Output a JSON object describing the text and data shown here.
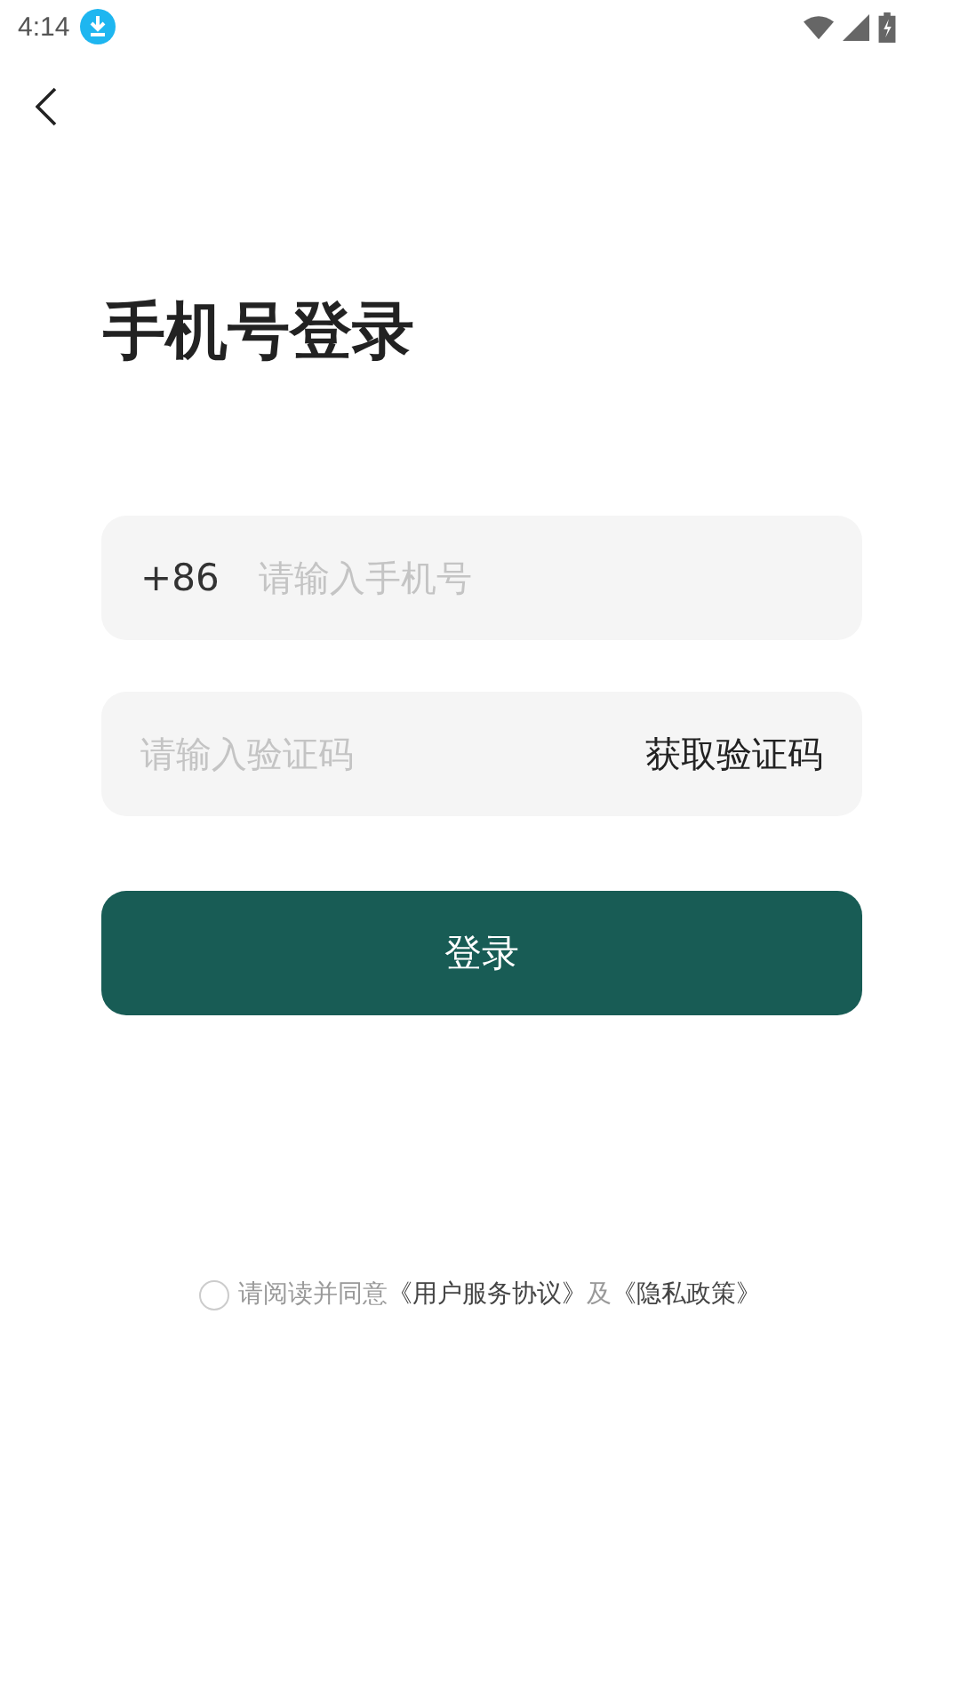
{
  "status_bar": {
    "time": "4:14"
  },
  "title": "手机号登录",
  "phone_field": {
    "prefix": "+86",
    "placeholder": "请输入手机号"
  },
  "code_field": {
    "placeholder": "请输入验证码",
    "action": "获取验证码"
  },
  "login_button": "登录",
  "agreement": {
    "checked": false,
    "parts": [
      {
        "kind": "text",
        "text": "请阅读并同意"
      },
      {
        "kind": "link",
        "text": "《用户服务协议》"
      },
      {
        "kind": "text",
        "text": "及"
      },
      {
        "kind": "link",
        "text": "《隐私政策》"
      }
    ]
  }
}
